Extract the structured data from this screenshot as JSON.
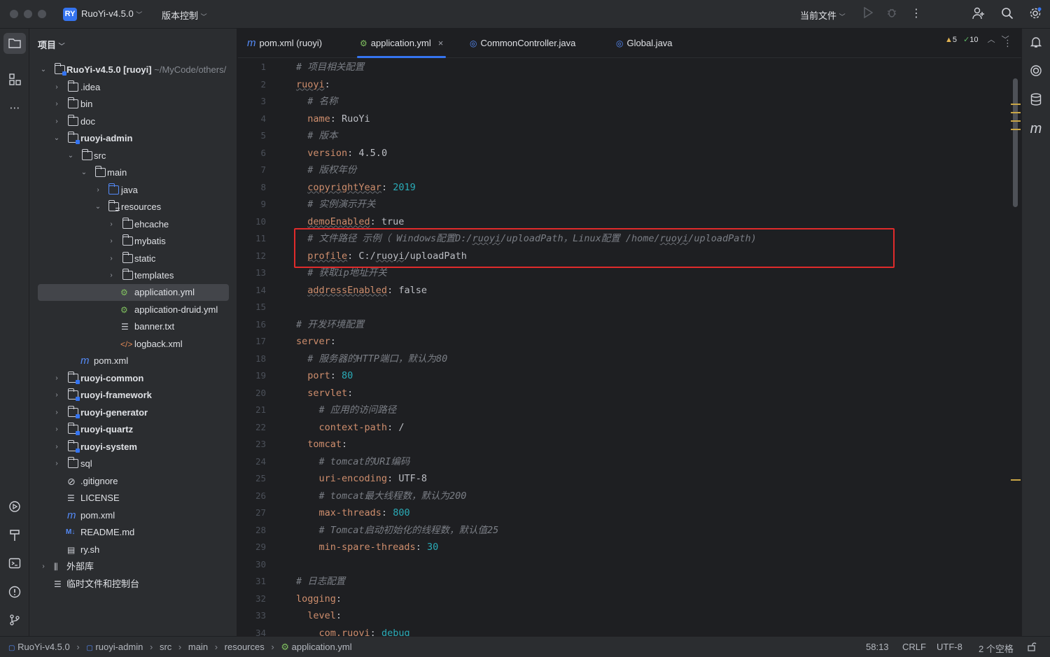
{
  "titlebar": {
    "project_badge": "RY",
    "project_name": "RuoYi-v4.5.0",
    "vcs_menu": "版本控制",
    "run_config": "当前文件"
  },
  "left_strip": {
    "icons": [
      "folder-icon",
      "structure-icon",
      "more-icon",
      "services-icon",
      "build-icon",
      "terminal-icon",
      "problems-icon",
      "git-icon"
    ]
  },
  "project": {
    "header": "项目",
    "root_label": "RuoYi-v4.5.0 [ruoyi]",
    "root_path": "~/MyCode/others/",
    "items": [
      {
        "label": ".idea"
      },
      {
        "label": "bin"
      },
      {
        "label": "doc"
      },
      {
        "label": "ruoyi-admin"
      },
      {
        "label": "src"
      },
      {
        "label": "main"
      },
      {
        "label": "java"
      },
      {
        "label": "resources"
      },
      {
        "label": "ehcache"
      },
      {
        "label": "mybatis"
      },
      {
        "label": "static"
      },
      {
        "label": "templates"
      },
      {
        "label": "application.yml"
      },
      {
        "label": "application-druid.yml"
      },
      {
        "label": "banner.txt"
      },
      {
        "label": "logback.xml"
      },
      {
        "label": "pom.xml"
      },
      {
        "label": "ruoyi-common"
      },
      {
        "label": "ruoyi-framework"
      },
      {
        "label": "ruoyi-generator"
      },
      {
        "label": "ruoyi-quartz"
      },
      {
        "label": "ruoyi-system"
      },
      {
        "label": "sql"
      },
      {
        "label": ".gitignore"
      },
      {
        "label": "LICENSE"
      },
      {
        "label": "pom.xml"
      },
      {
        "label": "README.md"
      },
      {
        "label": "ry.sh"
      },
      {
        "label": "外部库"
      },
      {
        "label": "临时文件和控制台"
      }
    ]
  },
  "tabs": [
    {
      "label": "pom.xml (ruoyi)",
      "icon": "maven-icon"
    },
    {
      "label": "application.yml",
      "icon": "yaml-icon",
      "active": true
    },
    {
      "label": "CommonController.java",
      "icon": "class-icon"
    },
    {
      "label": "Global.java",
      "icon": "class-icon"
    }
  ],
  "inspections": {
    "warnings": "5",
    "ok": "10"
  },
  "code_lines": [
    "# 项目相关配置",
    "ruoyi:",
    "  # 名称",
    "  name: RuoYi",
    "  # 版本",
    "  version: 4.5.0",
    "  # 版权年份",
    "  copyrightYear: 2019",
    "  # 实例演示开关",
    "  demoEnabled: true",
    "  # 文件路径 示例（ Windows配置D:/ruoyi/uploadPath，Linux配置 /home/ruoyi/uploadPath)",
    "  profile: C:/ruoyi/uploadPath",
    "  # 获取ip地址开关",
    "  addressEnabled: false",
    "",
    "# 开发环境配置",
    "server:",
    "  # 服务器的HTTP端口，默认为80",
    "  port: 80",
    "  servlet:",
    "    # 应用的访问路径",
    "    context-path: /",
    "  tomcat:",
    "    # tomcat的URI编码",
    "    uri-encoding: UTF-8",
    "    # tomcat最大线程数，默认为200",
    "    max-threads: 800",
    "    # Tomcat启动初始化的线程数，默认值25",
    "    min-spare-threads: 30",
    "",
    "# 日志配置",
    "logging:",
    "  level:",
    "    com.ruoyi: debug"
  ],
  "statusbar": {
    "breadcrumbs": [
      "RuoYi-v4.5.0",
      "ruoyi-admin",
      "src",
      "main",
      "resources",
      "application.yml"
    ],
    "position": "58:13",
    "line_sep": "CRLF",
    "encoding": "UTF-8",
    "indent": "2 个空格"
  }
}
